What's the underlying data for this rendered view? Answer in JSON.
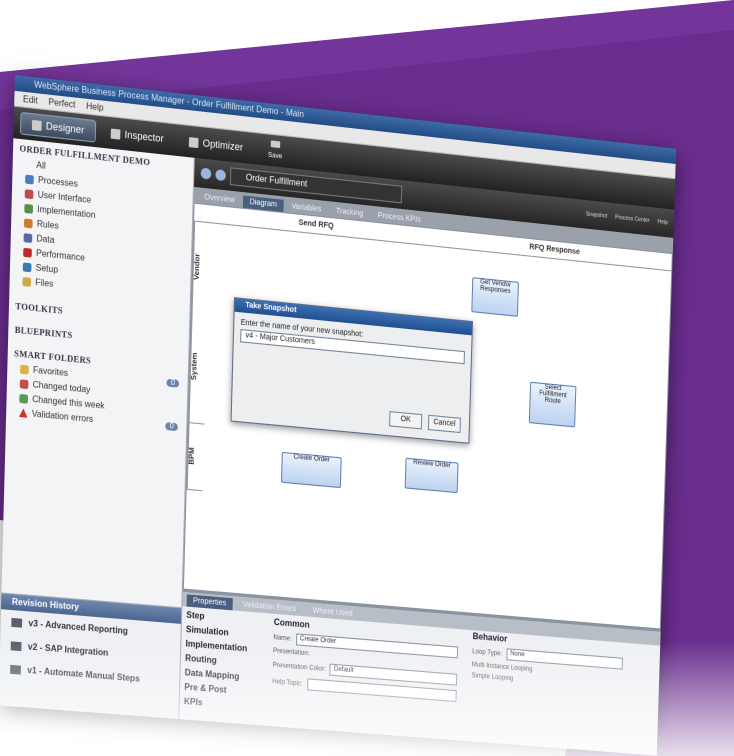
{
  "window": {
    "title": "WebSphere Business Process Manager - Order Fulfillment Demo - Main"
  },
  "menu": [
    "Edit",
    "Perfect",
    "Help"
  ],
  "toolbar": {
    "designer": "Designer",
    "inspector": "Inspector",
    "optimizer": "Optimizer",
    "save": "Save"
  },
  "sidebar": {
    "project": "ORDER FULFILLMENT DEMO",
    "all": "All",
    "items": [
      "Processes",
      "User Interface",
      "Implementation",
      "Rules",
      "Data",
      "Performance",
      "Setup",
      "Files"
    ],
    "toolkits": "TOOLKITS",
    "blueprints": "BLUEPRINTS",
    "smart_folders": "SMART FOLDERS",
    "folders": [
      {
        "label": "Favorites",
        "badge": "0"
      },
      {
        "label": "Changed today",
        "badge": ""
      },
      {
        "label": "Changed this week",
        "badge": ""
      },
      {
        "label": "Validation errors",
        "badge": "0"
      }
    ]
  },
  "history": {
    "title": "Revision History",
    "items": [
      "v3 - Advanced Reporting",
      "v2 - SAP Integration",
      "v1 - Automate Manual Steps"
    ]
  },
  "editor": {
    "document": "Order Fulfillment",
    "tabs": [
      "Overview",
      "Diagram",
      "Variables",
      "Tracking",
      "Process KPIs"
    ],
    "right_actions": [
      "Snapshot",
      "Process Center",
      "Help"
    ],
    "lanes": [
      "Send RFQ",
      "RFQ Response"
    ],
    "lane_labels": [
      "Vendor",
      "System",
      "BPM"
    ],
    "boxes": [
      "Get Vendor Responses",
      "Select Fulfillment Route",
      "Create Order",
      "Review Order"
    ]
  },
  "dialog": {
    "title": "Take Snapshot",
    "prompt": "Enter the name of your new snapshot:",
    "value": "v4 - Major Customers",
    "ok": "OK",
    "cancel": "Cancel"
  },
  "properties": {
    "tabs": [
      "Properties",
      "Validation Errors",
      "Where Used"
    ],
    "sections": [
      "Step",
      "Simulation",
      "Implementation",
      "Routing",
      "Data Mapping",
      "Pre & Post",
      "KPIs"
    ],
    "common": "Common",
    "name_label": "Name:",
    "name_value": "Create Order",
    "presentation_label": "Presentation:",
    "presentation_color_label": "Presentation Color:",
    "presentation_color": "Default",
    "help_label": "Help Topic:",
    "behavior": "Behavior",
    "loop_label": "Loop Type:",
    "loop_value": "None",
    "multi": "Multi Instance Looping",
    "simple": "Simple Looping"
  }
}
